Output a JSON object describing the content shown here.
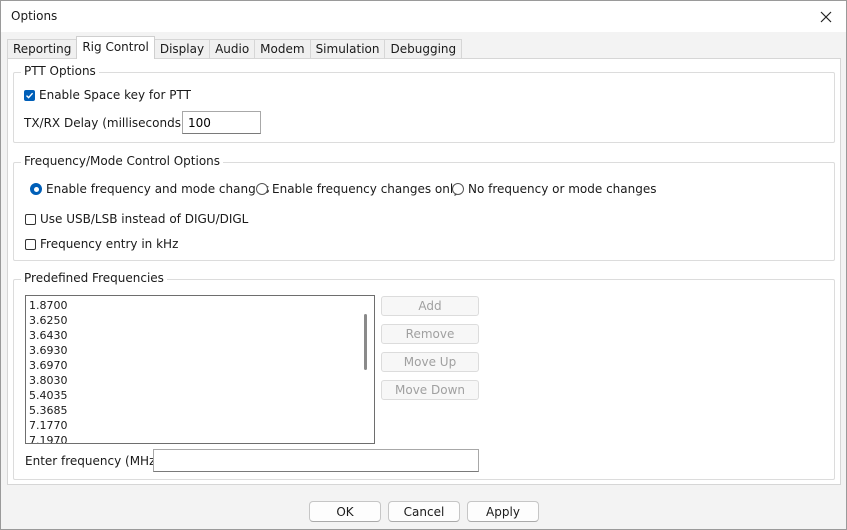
{
  "window": {
    "title": "Options",
    "close_icon": "close-icon"
  },
  "tabs": [
    {
      "label": "Reporting",
      "active": false
    },
    {
      "label": "Rig Control",
      "active": true
    },
    {
      "label": "Display",
      "active": false
    },
    {
      "label": "Audio",
      "active": false
    },
    {
      "label": "Modem",
      "active": false
    },
    {
      "label": "Simulation",
      "active": false
    },
    {
      "label": "Debugging",
      "active": false
    }
  ],
  "ptt": {
    "group_title": "PTT Options",
    "space_key_label": "Enable Space key for PTT",
    "space_key_checked": true,
    "delay_label": "TX/RX Delay (milliseconds):",
    "delay_value": "100"
  },
  "freq_mode": {
    "group_title": "Frequency/Mode Control Options",
    "radio_options": [
      {
        "label": "Enable frequency and mode changes",
        "checked": true
      },
      {
        "label": "Enable frequency changes only",
        "checked": false
      },
      {
        "label": "No frequency or mode changes",
        "checked": false
      }
    ],
    "usb_lsb_label": "Use USB/LSB instead of DIGU/DIGL",
    "usb_lsb_checked": false,
    "khz_label": "Frequency entry in kHz",
    "khz_checked": false
  },
  "predefined": {
    "group_title": "Predefined Frequencies",
    "items": [
      "1.8700",
      "3.6250",
      "3.6430",
      "3.6930",
      "3.6970",
      "3.8030",
      "5.4035",
      "5.3685",
      "7.1770",
      "7.1970"
    ],
    "add_label": "Add",
    "remove_label": "Remove",
    "move_up_label": "Move Up",
    "move_down_label": "Move Down",
    "enter_label": "Enter frequency (MHz):",
    "enter_value": ""
  },
  "footer": {
    "ok_label": "OK",
    "cancel_label": "Cancel",
    "apply_label": "Apply"
  }
}
